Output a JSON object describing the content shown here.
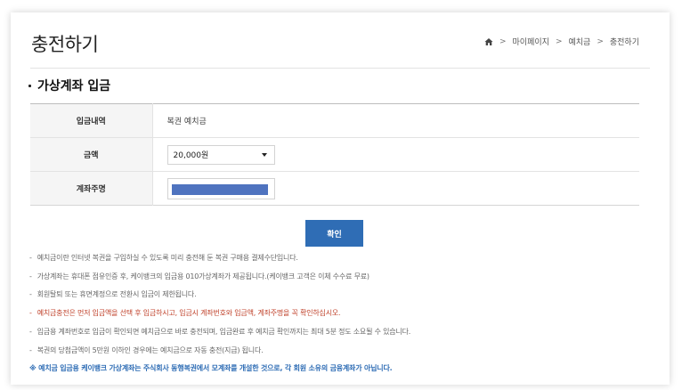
{
  "page": {
    "title": "충전하기"
  },
  "breadcrumb": {
    "home_icon": "home-icon",
    "items": [
      "마이페이지",
      "예치금",
      "충전하기"
    ]
  },
  "section": {
    "title": "가상계좌 입금"
  },
  "form": {
    "rows": [
      {
        "label": "입금내역",
        "value": "복권 예치금"
      },
      {
        "label": "금액",
        "selected": "20,000원"
      },
      {
        "label": "계좌주명",
        "masked": true
      }
    ]
  },
  "confirm_label": "확인",
  "notes": [
    "예치금이란 인터넷 복권을 구입하실 수 있도록 미리 충전해 둔 복권 구매용 결제수단입니다.",
    "가상계좌는 휴대폰 점유인증 후, 케이뱅크의 입금용 010가상계좌가 제공됩니다.(케이뱅크 고객은 이체 수수료 무료)",
    "회원탈퇴 또는 휴면계정으로 전환시 입금이 제한됩니다.",
    "예치금충전은 먼저 입금액을 선택 후 입금하시고, 입금시 계좌번호와 입금액, 계좌주명을 꼭 확인하십시오.",
    "입금용 계좌번호로 입금이 확인되면 예치금으로 바로 충전되며, 입금완료 후 예치금 확인까지는 최대 5분 정도 소요될 수 있습니다.",
    "복권의 당첨금액이 5만원 이하인 경우에는 예치금으로 자동 충전(지급) 됩니다."
  ],
  "notice": "※ 예치금 입금용 케이뱅크 가상계좌는 주식회사 동행복권에서 모계좌를 개설한 것으로, 각 회원 소유의 금융계좌가 아닙니다.",
  "colors": {
    "accent": "#2f6db5",
    "warning": "#c0432c",
    "mask": "#4f73bf"
  }
}
